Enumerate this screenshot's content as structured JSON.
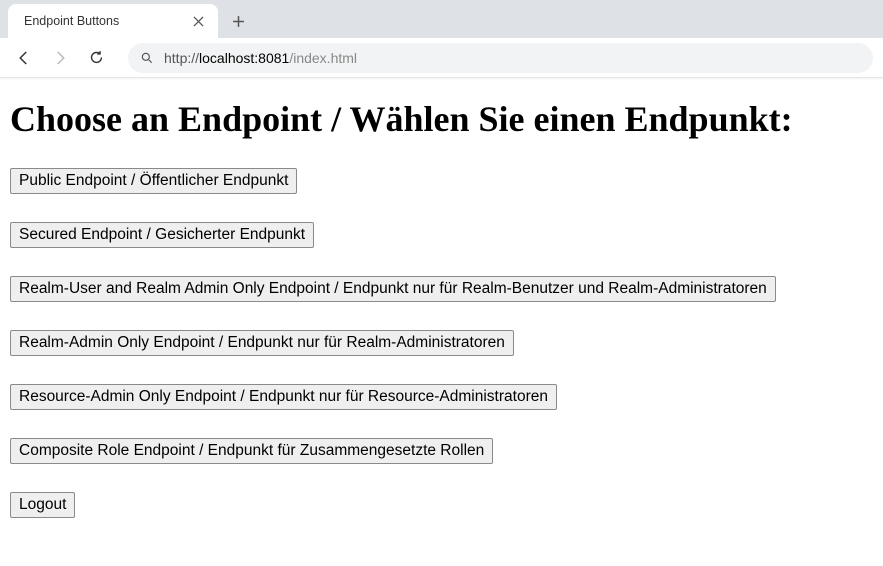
{
  "browser": {
    "tab_title": "Endpoint Buttons",
    "url_prefix": "http://",
    "url_host": "localhost:8081",
    "url_path": "/index.html"
  },
  "page": {
    "heading": "Choose an Endpoint / Wählen Sie einen Endpunkt:",
    "buttons": {
      "public": "Public Endpoint / Öffentlicher Endpunkt",
      "secured": "Secured Endpoint / Gesicherter Endpunkt",
      "realm_user_admin": "Realm-User and Realm Admin Only Endpoint / Endpunkt nur für Realm-Benutzer und Realm-Administratoren",
      "realm_admin": "Realm-Admin Only Endpoint / Endpunkt nur für Realm-Administratoren",
      "resource_admin": "Resource-Admin Only Endpoint / Endpunkt nur für Resource-Administratoren",
      "composite": "Composite Role Endpoint / Endpunkt für Zusammengesetzte Rollen",
      "logout": "Logout"
    }
  }
}
